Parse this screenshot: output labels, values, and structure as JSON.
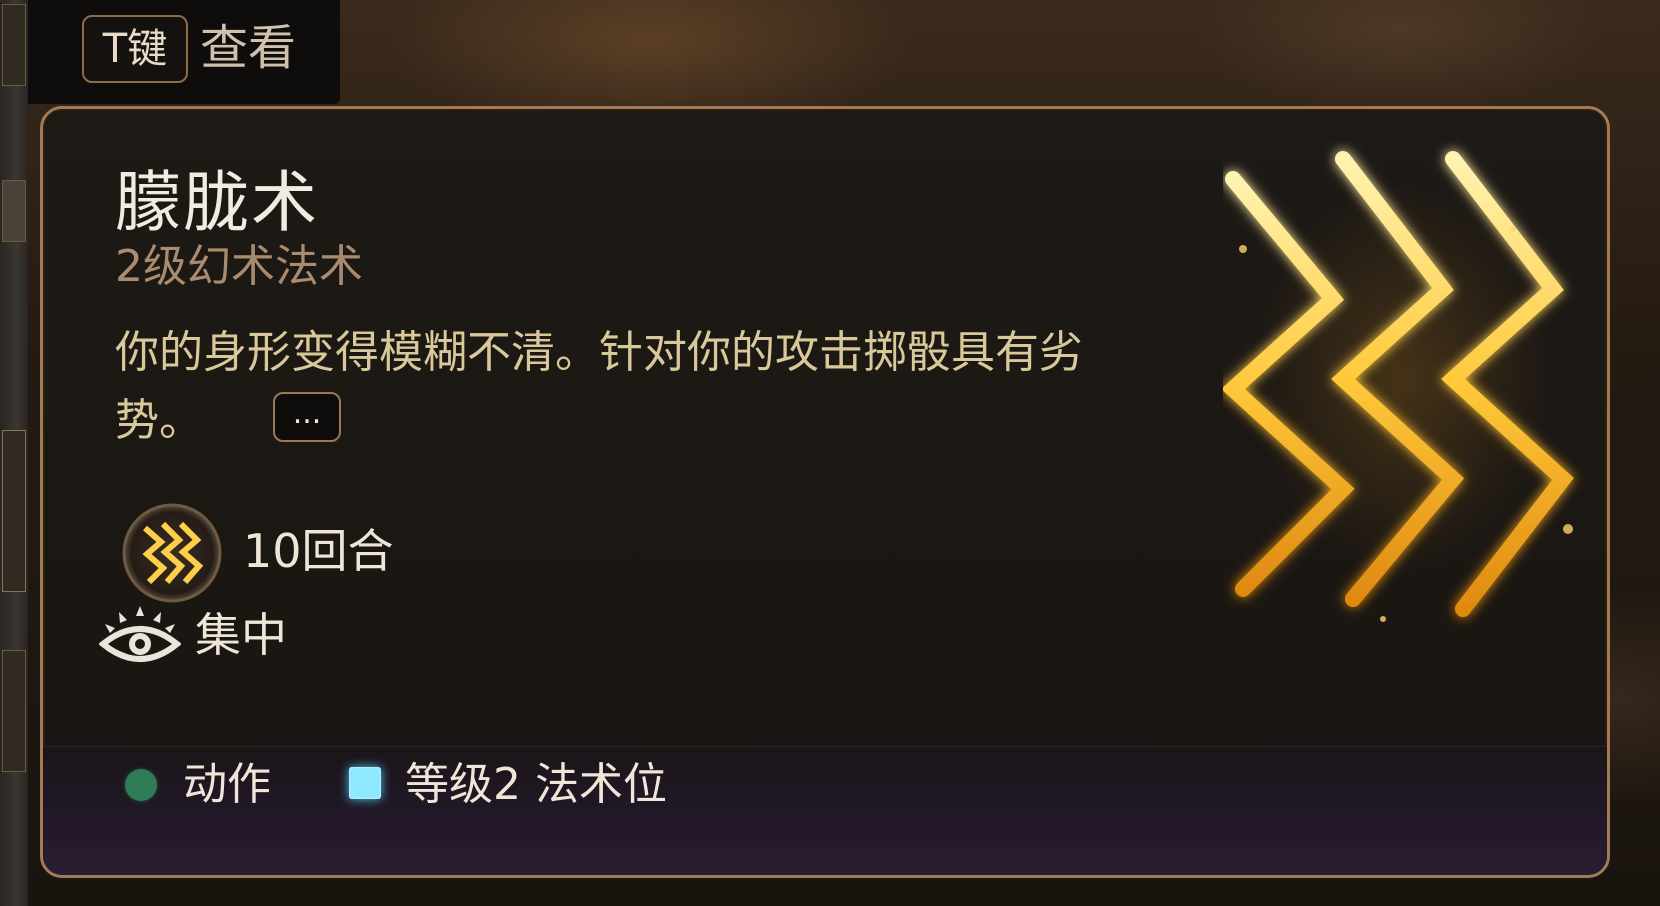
{
  "hotkey": {
    "key": "T键",
    "label": "查看"
  },
  "spell": {
    "name": "朦胧术",
    "level_school": "2级幻术法术",
    "description": "你的身形变得模糊不清。针对你的攻击掷骰具有劣势。",
    "more_label": "...",
    "duration": "10回合",
    "concentration": "集中"
  },
  "costs": {
    "action": {
      "label": "动作",
      "color": "#2f7a57"
    },
    "spell_slot": {
      "label": "等级2 法术位",
      "color": "#8ee8ff"
    }
  },
  "icons": {
    "duration": "blur-zigzag-icon",
    "concentration": "concentration-eye-icon",
    "spell_art": "golden-zigzag-art"
  },
  "colors": {
    "panel_border": "#a37a55",
    "description_text": "#d9c89a",
    "level_text": "#a98c70"
  }
}
